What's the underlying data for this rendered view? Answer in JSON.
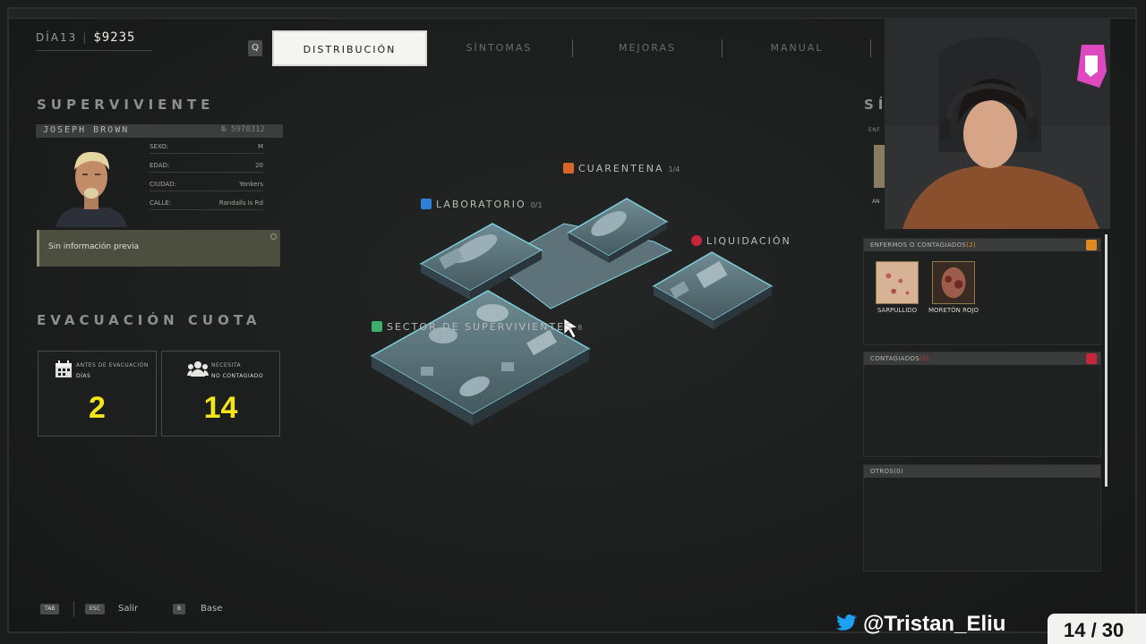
{
  "header": {
    "day": "DÍA13",
    "separator": "|",
    "money": "$9235",
    "q_key": "Q",
    "tabs": [
      {
        "label": "DISTRIBUCIÓN",
        "active": true
      },
      {
        "label": "SÍNTOMAS",
        "active": false
      },
      {
        "label": "MEJORAS",
        "active": false
      },
      {
        "label": "MANUAL",
        "active": false
      }
    ]
  },
  "survivor": {
    "section_title": "SUPERVIVIENTE",
    "name": "JOSEPH BROWN",
    "id": "№ 5978312",
    "fields": [
      {
        "label": "SEXO:",
        "value": "M"
      },
      {
        "label": "EDAD:",
        "value": "20"
      },
      {
        "label": "CIUDAD:",
        "value": "Yonkers"
      },
      {
        "label": "CALLE:",
        "value": "Randalls Is Rd"
      }
    ],
    "note": "Sin información previa"
  },
  "quota": {
    "section_title": "EVACUACIÓN CUOTA",
    "days": {
      "label1": "ANTES DE EVACUACIÓN",
      "label2": "DÍAS",
      "value": "2",
      "icon": "calendar-icon"
    },
    "needed": {
      "label1": "NECESITA",
      "label2": "NO CONTAGIADO",
      "value": "14",
      "icon": "people-icon"
    }
  },
  "map": {
    "rooms": [
      {
        "name": "CUARENTENA",
        "capacity": "1/4",
        "color": "#d9652a"
      },
      {
        "name": "LABORATORIO",
        "capacity": "0/1",
        "color": "#2f7fd6"
      },
      {
        "name": "LIQUIDACIÓN",
        "capacity": "",
        "color": "#c8243c"
      },
      {
        "name": "SECTOR DE SUPERVIVIENTES",
        "capacity": "8",
        "color": "#3fae6a"
      }
    ]
  },
  "symptoms_panel": {
    "title": "SÍ",
    "sub": "ENF",
    "mini_label": "AN",
    "sections": [
      {
        "title": "ENFERMOS O CONTAGIADOS",
        "count": "(2)",
        "items": [
          {
            "name": "SARPULLIDO"
          },
          {
            "name": "MORETÓN ROJO"
          }
        ]
      },
      {
        "title": "CONTAGIADOS",
        "count": "(0)",
        "items": []
      },
      {
        "title": "OTROS",
        "count": "(0)",
        "items": []
      }
    ]
  },
  "footer": {
    "tab_key": "TAB",
    "esc_key": "ESC",
    "esc_label": "Salir",
    "b_key": "B",
    "b_label": "Base"
  },
  "stream": {
    "twitter_handle": "@Tristan_Eliu",
    "counter": "14 / 30"
  },
  "colors": {
    "accent_yellow": "#f2e51c",
    "active_tab_bg": "#f4f4f1",
    "warning_orange": "#e08a20",
    "danger_red": "#d0304a",
    "room_outline": "#6fc7d8"
  }
}
